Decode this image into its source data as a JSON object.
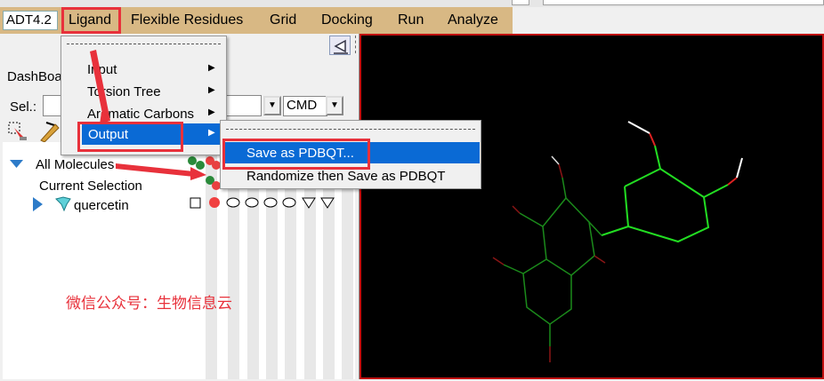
{
  "menubar": {
    "app_version": "ADT4.2",
    "items": [
      "Ligand",
      "Flexible Residues",
      "Grid",
      "Docking",
      "Run",
      "Analyze"
    ]
  },
  "dashboard": {
    "label": "DashBoa",
    "sel_label": "Sel.:",
    "cmd_value": "CMD",
    "tree": {
      "all_molecules": "All Molecules",
      "current_selection": "Current Selection",
      "molecule": "quercetin"
    }
  },
  "ligand_menu": {
    "items": [
      "Input",
      "Torsion Tree",
      "Aromatic Carbons",
      "Output"
    ],
    "selected": "Output"
  },
  "output_submenu": {
    "items": [
      "Save as PDBQT...",
      "Randomize then Save as PDBQT"
    ],
    "selected": "Save as PDBQT..."
  },
  "watermark": "微信公众号：生物信息云",
  "colors": {
    "menubar": "#d8b884",
    "highlight": "#0a6ad5",
    "annotation_red": "#e8313b",
    "bond_green": "#22dd22",
    "oxygen_red": "#dd2222"
  }
}
